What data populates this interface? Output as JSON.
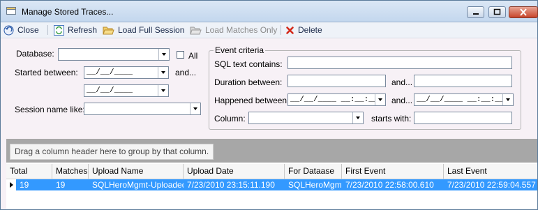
{
  "window": {
    "title": "Manage Stored Traces..."
  },
  "toolbar": {
    "close": "Close",
    "refresh": "Refresh",
    "load_full": "Load Full Session",
    "load_matches": "Load Matches Only",
    "delete": "Delete"
  },
  "filters": {
    "database_label": "Database:",
    "database_value": "",
    "all_label": "All",
    "started_label": "Started between:",
    "started_from": "__/__/____",
    "and": "and...",
    "started_to": "__/__/____",
    "session_label": "Session name like:",
    "session_value": ""
  },
  "event_criteria": {
    "title": "Event criteria",
    "sql_label": "SQL text contains:",
    "sql_value": "",
    "duration_label": "Duration between:",
    "duration_from": "",
    "and": "and...",
    "duration_to": "",
    "happened_label": "Happened between:",
    "happened_from": "__/__/____ __:__:__ __",
    "and2": "and...",
    "happened_to": "__/__/____ __:__:__ __",
    "column_label": "Column:",
    "column_value": "",
    "starts_label": "starts with:",
    "starts_value": ""
  },
  "grid": {
    "group_hint": "Drag a column header here to group by that column.",
    "columns": [
      "Total",
      "Matches",
      "Upload Name",
      "Upload Date",
      "For Dataase",
      "First Event",
      "Last Event"
    ],
    "rows": [
      [
        "19",
        "19",
        "SQLHeroMgmt-Uploaded",
        "7/23/2010 23:15:11.190",
        "SQLHeroMgmt",
        "7/23/2010 22:58:00.610",
        "7/23/2010 22:59:04.557"
      ]
    ]
  },
  "colors": {
    "selection": "#3399ff",
    "group_bar": "#a7a7a7",
    "accent": "#1a2a4a"
  }
}
